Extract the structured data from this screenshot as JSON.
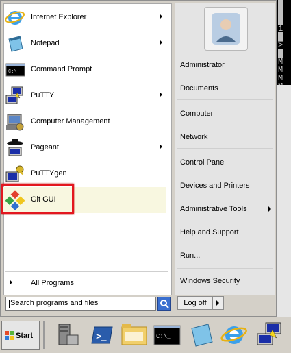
{
  "programs": [
    {
      "label": "Internet Explorer",
      "has_submenu": true,
      "icon": "internet-explorer-icon"
    },
    {
      "label": "Notepad",
      "has_submenu": true,
      "icon": "notepad-icon"
    },
    {
      "label": "Command Prompt",
      "has_submenu": false,
      "icon": "command-prompt-icon"
    },
    {
      "label": "PuTTY",
      "has_submenu": true,
      "icon": "putty-icon"
    },
    {
      "label": "Computer Management",
      "has_submenu": false,
      "icon": "computer-management-icon"
    },
    {
      "label": "Pageant",
      "has_submenu": true,
      "icon": "pageant-icon"
    },
    {
      "label": "PuTTYgen",
      "has_submenu": false,
      "icon": "puttygen-icon"
    },
    {
      "label": "Git GUI",
      "has_submenu": false,
      "icon": "git-gui-icon"
    }
  ],
  "all_programs_label": "All Programs",
  "search": {
    "placeholder": "Search programs and files"
  },
  "right_items": [
    {
      "label": "Administrator",
      "has_submenu": false
    },
    {
      "label": "Documents",
      "has_submenu": false
    },
    {
      "label": "Computer",
      "has_submenu": false
    },
    {
      "label": "Network",
      "has_submenu": false
    },
    {
      "label": "Control Panel",
      "has_submenu": false
    },
    {
      "label": "Devices and Printers",
      "has_submenu": false
    },
    {
      "label": "Administrative Tools",
      "has_submenu": true
    },
    {
      "label": "Help and Support",
      "has_submenu": false
    },
    {
      "label": "Run...",
      "has_submenu": false
    },
    {
      "label": "Windows Security",
      "has_submenu": false
    }
  ],
  "logoff_label": "Log off",
  "taskbar": {
    "start_label": "Start",
    "icons": [
      "server-manager-icon",
      "powershell-icon",
      "explorer-folder-icon",
      "command-prompt-icon",
      "notepad-icon",
      "internet-explorer-icon",
      "putty-icon"
    ]
  },
  "colors": {
    "highlight": "#e3171f",
    "selected_row": "#f8f7e0"
  }
}
